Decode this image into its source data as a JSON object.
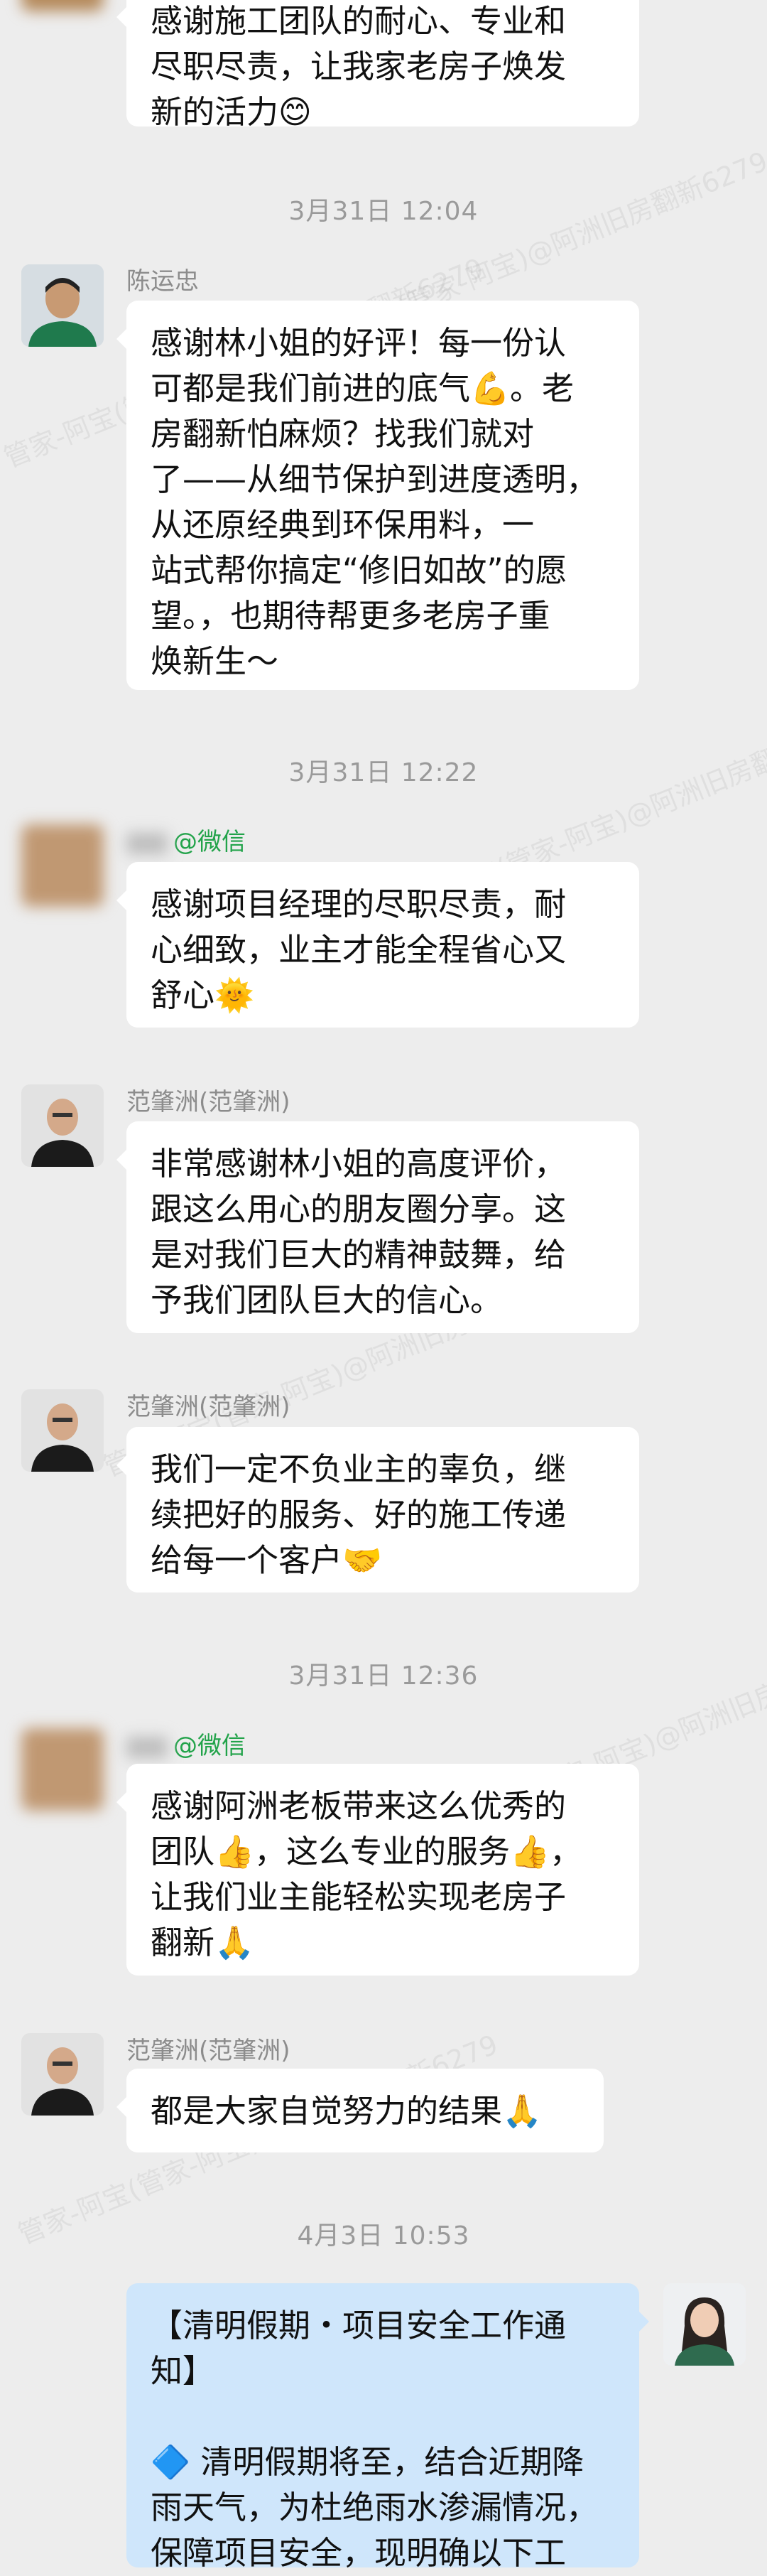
{
  "messages": {
    "m0": {
      "lines": [
        "感谢施工团队的耐心、专业和",
        "尽职尽责，让我家老房子焕发",
        "新的活力😊"
      ]
    },
    "t1": "3月31日  12:04",
    "m1": {
      "sender": "陈运忠",
      "lines": [
        "感谢林小姐的好评！每一份认",
        "可都是我们前进的底气💪。老",
        "房翻新怕麻烦？找我们就对",
        "了——从细节保护到进度透明，",
        "从还原经典到环保用料，一",
        "站式帮你搞定“修旧如故”的愿",
        "望。，也期待帮更多老房子重",
        "焕新生～"
      ]
    },
    "t2": "3月31日  12:22",
    "m2": {
      "sender_suffix": "@微信",
      "lines": [
        "感谢项目经理的尽职尽责，耐",
        "心细致，业主才能全程省心又",
        "舒心🌞"
      ]
    },
    "m3": {
      "sender": "范肇洲(范肇洲)",
      "lines": [
        "非常感谢林小姐的高度评价，",
        "跟这么用心的朋友圈分享。这",
        "是对我们巨大的精神鼓舞，给",
        "予我们团队巨大的信心。"
      ]
    },
    "m4": {
      "sender": "范肇洲(范肇洲)",
      "lines": [
        "我们一定不负业主的辜负，继",
        "续把好的服务、好的施工传递",
        "给每一个客户🤝"
      ]
    },
    "t3": "3月31日  12:36",
    "m5": {
      "sender_suffix": "@微信",
      "lines": [
        "感谢阿洲老板带来这么优秀的",
        "团队👍，这么专业的服务👍，",
        "让我们业主能轻松实现老房子",
        "翻新🙏"
      ]
    },
    "m6": {
      "sender": "范肇洲(范肇洲)",
      "lines": [
        "都是大家自觉努力的结果🙏"
      ]
    },
    "t4": "4月3日  10:53",
    "m7": {
      "lines": [
        "【清明假期・项目安全工作通",
        "知】",
        "",
        "🔷 清明假期将至，结合近期降",
        "雨天气，为杜绝雨水渗漏情况，",
        "保障项目安全，现明确以下工"
      ]
    }
  },
  "watermark_text": "管家-阿宝(管家-阿宝)@阿洲旧房翻新6279",
  "colors": {
    "background": "#ededed",
    "bubble_in": "#ffffff",
    "bubble_notice": "#cfe6fb",
    "wechat_green": "#22a34a",
    "timestamp": "#9a9a9a"
  }
}
